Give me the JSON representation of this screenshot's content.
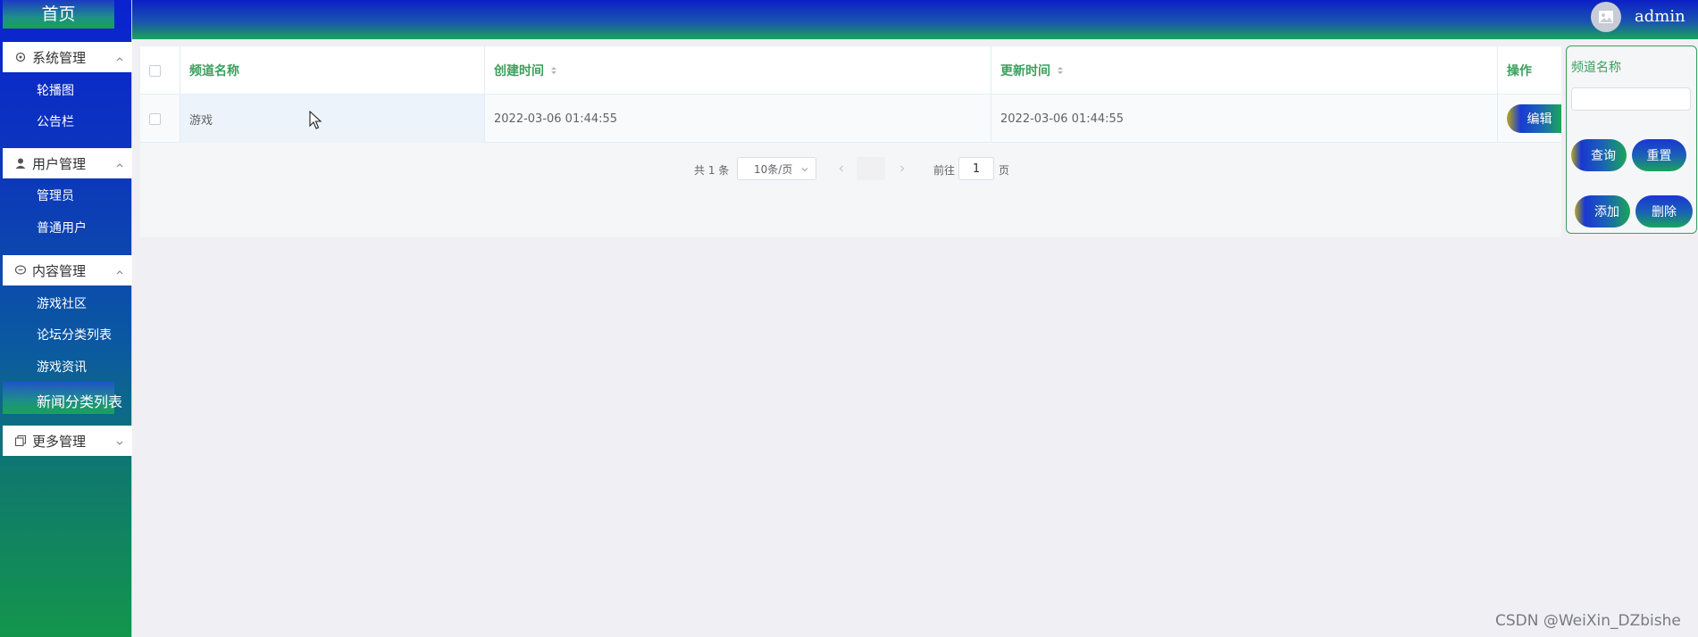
{
  "header": {
    "username": "admin",
    "avatar_icon": "image-placeholder-icon"
  },
  "sidebar": {
    "home_label": "首页",
    "groups": [
      {
        "label": "系统管理",
        "icon": "gear-icon",
        "expanded": true,
        "items": [
          "轮播图",
          "公告栏"
        ]
      },
      {
        "label": "用户管理",
        "icon": "user-icon",
        "expanded": true,
        "items": [
          "管理员",
          "普通用户"
        ]
      },
      {
        "label": "内容管理",
        "icon": "chat-icon",
        "expanded": true,
        "items": [
          "游戏社区",
          "论坛分类列表",
          "游戏资讯"
        ]
      },
      {
        "label": "更多管理",
        "icon": "copy-icon",
        "expanded": false,
        "items": []
      }
    ],
    "active_item": "新闻分类列表"
  },
  "table": {
    "columns": [
      "频道名称",
      "创建时间",
      "更新时间",
      "操作"
    ],
    "rows": [
      {
        "name": "游戏",
        "created": "2022-03-06 01:44:55",
        "updated": "2022-03-06 01:44:55",
        "action": "编辑"
      }
    ]
  },
  "pagination": {
    "total": "共 1 条",
    "page_size": "10条/页",
    "goto_label": "前往",
    "page_input": "1",
    "page_suffix": "页"
  },
  "search": {
    "label": "频道名称",
    "query_button": "查询",
    "reset_button": "重置",
    "add_button": "添加",
    "delete_button": "删除"
  },
  "watermark": "CSDN @WeiXin_DZbishe",
  "colors": {
    "accent_green": "#3aa05c",
    "header_blue": "#0b1fc7",
    "sidebar_green": "#14954c"
  }
}
